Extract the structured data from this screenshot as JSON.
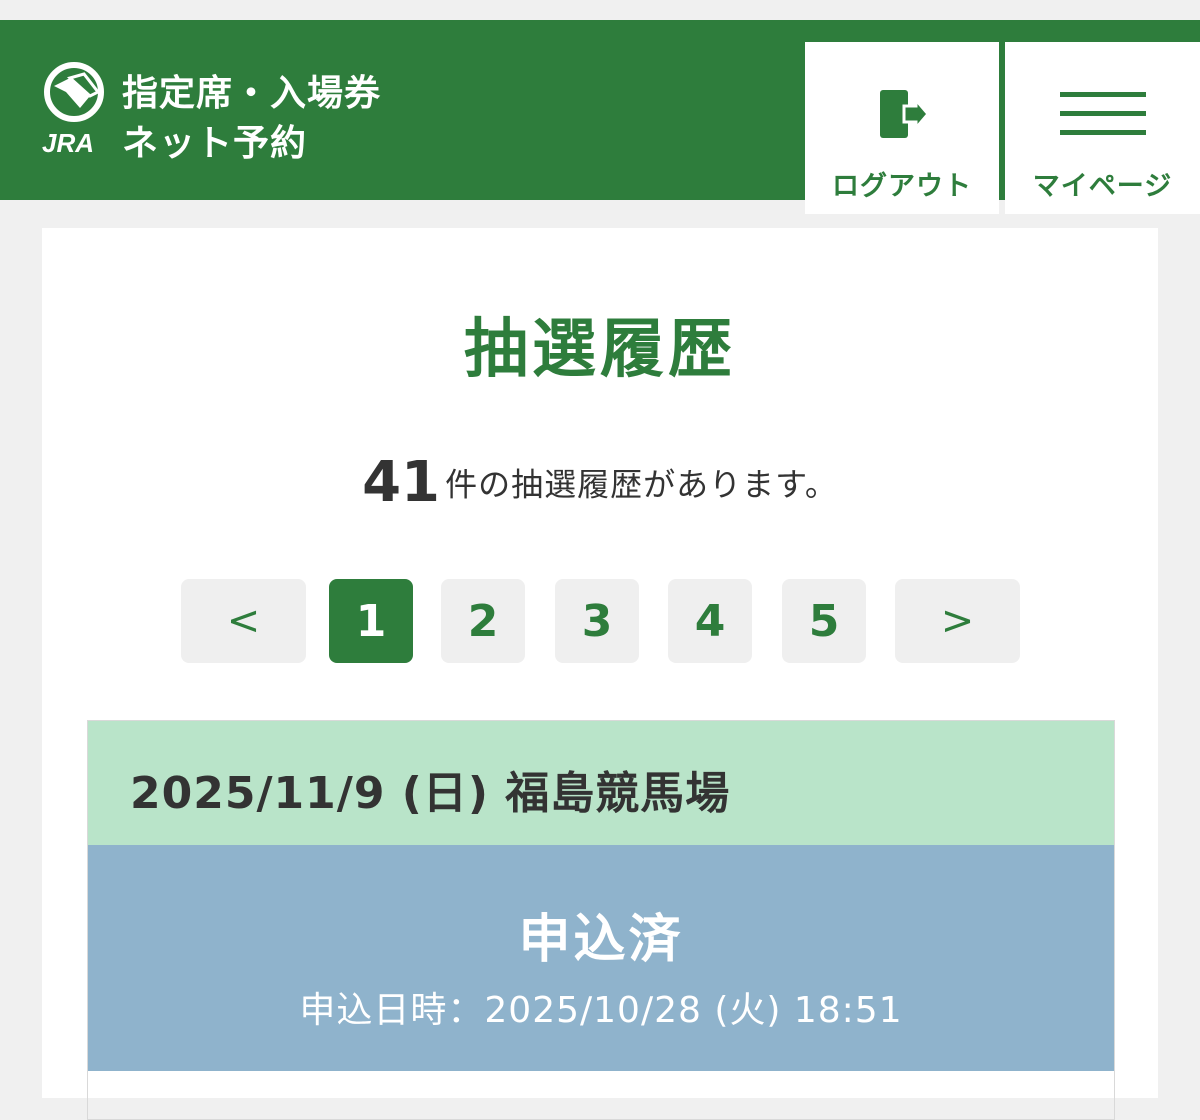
{
  "header": {
    "brand_logo_text": "JRA",
    "brand_line1": "指定席・入場券",
    "brand_line2": "ネット予約",
    "logout_label": "ログアウト",
    "mypage_label": "マイページ",
    "accent_color": "#2e7d3c"
  },
  "main": {
    "title": "抽選履歴",
    "count": "41",
    "count_text": "件の抽選履歴があります。"
  },
  "pagination": {
    "prev": "<",
    "next": ">",
    "pages": [
      "1",
      "2",
      "3",
      "4",
      "5"
    ],
    "current": "1"
  },
  "entries": [
    {
      "date_venue": "2025/11/9 (日) 福島競馬場",
      "status": "申込済",
      "applied_at": "申込日時：2025/10/28 (火) 18:51",
      "head_color": "#b9e4c9",
      "status_color": "#8fb3cc"
    }
  ]
}
